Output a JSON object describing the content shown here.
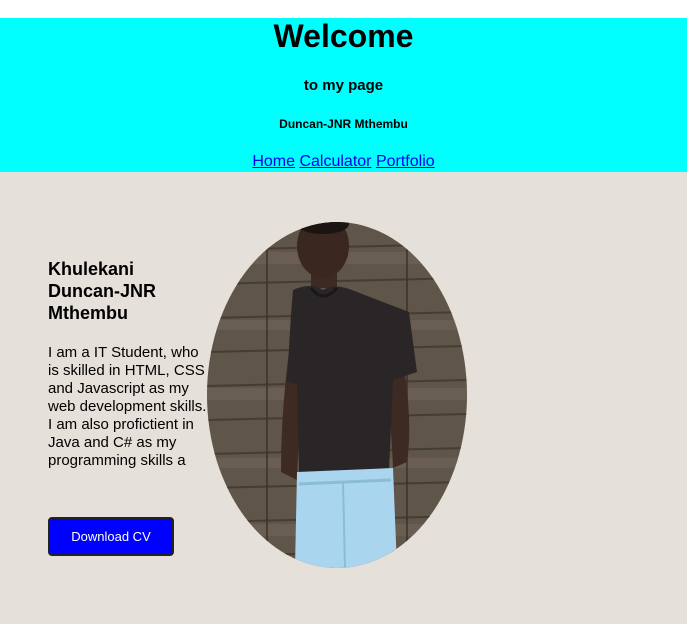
{
  "header": {
    "title": "Welcome",
    "subtitle": "to my page",
    "author": "Duncan-JNR Mthembu"
  },
  "nav": {
    "links": [
      {
        "label": "Home"
      },
      {
        "label": "Calculator"
      },
      {
        "label": "Portfolio"
      }
    ]
  },
  "profile": {
    "name": "Khulekani Duncan-JNR Mthembu",
    "bio": "I am a IT Student, who is skilled in HTML, CSS and Javascript as my web development skills. I am also profictient in Java and C# as my programming skills a",
    "download_label": "Download CV",
    "photo_icon": "profile-photo"
  },
  "colors": {
    "header_bg": "#00ffff",
    "main_bg": "#e6e0da",
    "button_bg": "#0000ff",
    "link": "#0000ee"
  }
}
